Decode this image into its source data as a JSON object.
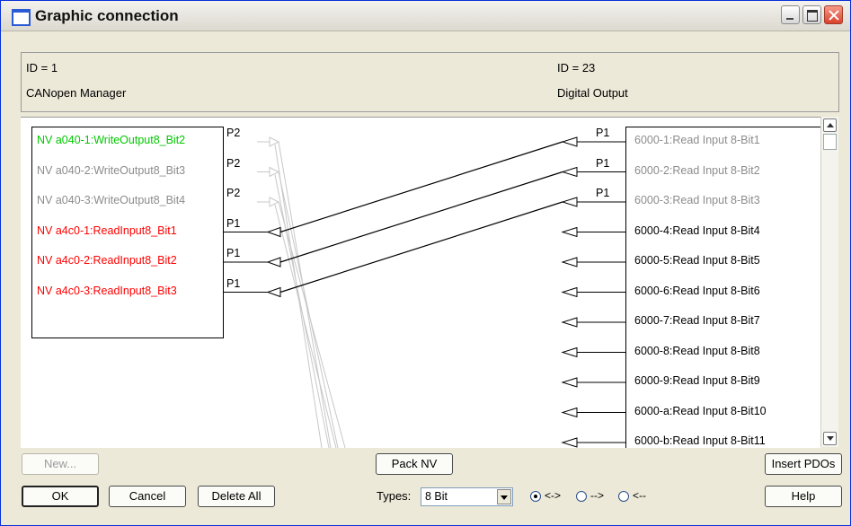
{
  "window": {
    "title": "Graphic connection"
  },
  "header": {
    "left_id": "ID = 1",
    "left_name": "CANopen Manager",
    "right_id": "ID = 23",
    "right_name": "Digital Output"
  },
  "colors": {
    "green": "#00c800",
    "gray": "#8c8c8c",
    "red": "#ff0000",
    "black": "#000000",
    "line_gray": "#c8c8c8"
  },
  "left_items": [
    {
      "text": "NV a040-1:WriteOutput8_Bit2",
      "port": "P2",
      "color": "green"
    },
    {
      "text": "NV a040-2:WriteOutput8_Bit3",
      "port": "P2",
      "color": "gray"
    },
    {
      "text": "NV a040-3:WriteOutput8_Bit4",
      "port": "P2",
      "color": "gray"
    },
    {
      "text": "NV a4c0-1:ReadInput8_Bit1",
      "port": "P1",
      "color": "red"
    },
    {
      "text": "NV a4c0-2:ReadInput8_Bit2",
      "port": "P1",
      "color": "red"
    },
    {
      "text": "NV a4c0-3:ReadInput8_Bit3",
      "port": "P1",
      "color": "red"
    }
  ],
  "right_items": [
    {
      "text": "6000-1:Read Input 8-Bit1",
      "port": "P1",
      "color": "gray"
    },
    {
      "text": "6000-2:Read Input 8-Bit2",
      "port": "P1",
      "color": "gray"
    },
    {
      "text": "6000-3:Read Input 8-Bit3",
      "port": "P1",
      "color": "gray"
    },
    {
      "text": "6000-4:Read Input 8-Bit4",
      "port": "",
      "color": "black"
    },
    {
      "text": "6000-5:Read Input 8-Bit5",
      "port": "",
      "color": "black"
    },
    {
      "text": "6000-6:Read Input 8-Bit6",
      "port": "",
      "color": "black"
    },
    {
      "text": "6000-7:Read Input 8-Bit7",
      "port": "",
      "color": "black"
    },
    {
      "text": "6000-8:Read Input 8-Bit8",
      "port": "",
      "color": "black"
    },
    {
      "text": "6000-9:Read Input 8-Bit9",
      "port": "",
      "color": "black"
    },
    {
      "text": "6000-a:Read Input 8-Bit10",
      "port": "",
      "color": "black"
    },
    {
      "text": "6000-b:Read Input 8-Bit11",
      "port": "",
      "color": "black"
    }
  ],
  "connections": [
    {
      "from": 3,
      "to": 0
    },
    {
      "from": 4,
      "to": 1
    },
    {
      "from": 5,
      "to": 2
    }
  ],
  "buttons": {
    "new": "New...",
    "pack_nv": "Pack NV",
    "insert_pdos": "Insert PDOs",
    "ok": "OK",
    "cancel": "Cancel",
    "delete_all": "Delete All",
    "help": "Help"
  },
  "types": {
    "label": "Types:",
    "selected": "8 Bit",
    "radios": [
      {
        "label": "<->",
        "checked": true
      },
      {
        "label": "-->",
        "checked": false
      },
      {
        "label": "<--",
        "checked": false
      }
    ]
  }
}
